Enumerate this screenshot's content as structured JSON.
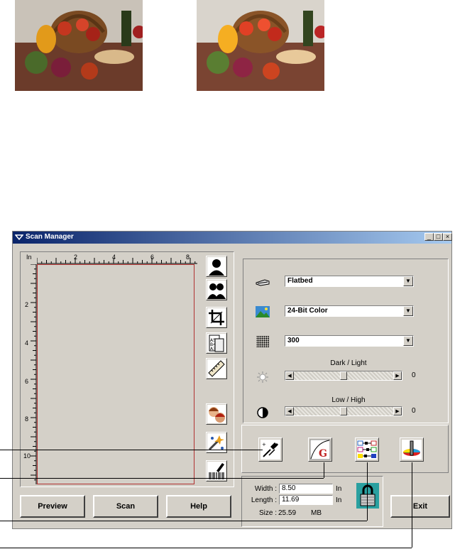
{
  "window": {
    "title": "Scan Manager",
    "controls": {
      "minimize": "_",
      "maximize": "□",
      "close": "×"
    }
  },
  "ruler": {
    "unit": "In",
    "top_numbers": [
      "2",
      "4",
      "6",
      "8"
    ],
    "left_numbers": [
      "2",
      "4",
      "6",
      "8",
      "10"
    ]
  },
  "tools": [
    {
      "name": "single-person-icon"
    },
    {
      "name": "two-people-icon"
    },
    {
      "name": "crop-icon"
    },
    {
      "name": "paper-size-icon"
    },
    {
      "name": "ruler-icon"
    },
    {
      "name": "faces-icon"
    },
    {
      "name": "sparkle-wand-icon"
    },
    {
      "name": "barcode-pen-icon"
    }
  ],
  "settings": {
    "source": {
      "value": "Flatbed",
      "icon": "flatbed-scanner-icon"
    },
    "mode": {
      "value": "24-Bit Color",
      "icon": "color-landscape-icon"
    },
    "resolution": {
      "value": "300",
      "icon": "halftone-dots-icon"
    },
    "brightness": {
      "label": "Dark / Light",
      "value": "0",
      "icon": "sun-icon",
      "level": 0.5
    },
    "contrast": {
      "label": "Low / High",
      "value": "0",
      "icon": "contrast-circle-icon",
      "level": 0.5
    }
  },
  "adjust_buttons": [
    {
      "name": "eyedropper-button",
      "icon": "eyedropper-icon"
    },
    {
      "name": "gamma-curve-button",
      "icon": "gamma-curve-icon"
    },
    {
      "name": "color-balance-button",
      "icon": "color-balance-icon"
    },
    {
      "name": "hue-saturation-button",
      "icon": "hue-saturation-icon"
    }
  ],
  "size_panel": {
    "width_label": "Width :",
    "width_value": "8.50",
    "length_label": "Length :",
    "length_value": "11.69",
    "unit": "In",
    "size_label": "Size :",
    "size_value": "25.59",
    "size_unit": "MB",
    "lock_icon": "padlock-icon"
  },
  "buttons": {
    "preview": "Preview",
    "scan": "Scan",
    "help": "Help",
    "exit": "Exit"
  },
  "colors": {
    "title_start": "#0a246a",
    "title_end": "#a6caf0",
    "face": "#d4d0c8",
    "preview_border": "#b03030"
  }
}
